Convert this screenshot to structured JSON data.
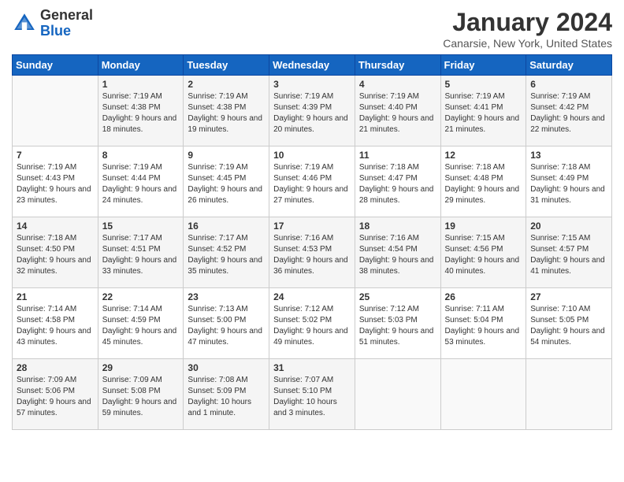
{
  "header": {
    "logo": {
      "line1": "General",
      "line2": "Blue"
    },
    "title": "January 2024",
    "location": "Canarsie, New York, United States"
  },
  "days_of_week": [
    "Sunday",
    "Monday",
    "Tuesday",
    "Wednesday",
    "Thursday",
    "Friday",
    "Saturday"
  ],
  "weeks": [
    [
      {
        "num": "",
        "sunrise": "",
        "sunset": "",
        "daylight": ""
      },
      {
        "num": "1",
        "sunrise": "Sunrise: 7:19 AM",
        "sunset": "Sunset: 4:38 PM",
        "daylight": "Daylight: 9 hours and 18 minutes."
      },
      {
        "num": "2",
        "sunrise": "Sunrise: 7:19 AM",
        "sunset": "Sunset: 4:38 PM",
        "daylight": "Daylight: 9 hours and 19 minutes."
      },
      {
        "num": "3",
        "sunrise": "Sunrise: 7:19 AM",
        "sunset": "Sunset: 4:39 PM",
        "daylight": "Daylight: 9 hours and 20 minutes."
      },
      {
        "num": "4",
        "sunrise": "Sunrise: 7:19 AM",
        "sunset": "Sunset: 4:40 PM",
        "daylight": "Daylight: 9 hours and 21 minutes."
      },
      {
        "num": "5",
        "sunrise": "Sunrise: 7:19 AM",
        "sunset": "Sunset: 4:41 PM",
        "daylight": "Daylight: 9 hours and 21 minutes."
      },
      {
        "num": "6",
        "sunrise": "Sunrise: 7:19 AM",
        "sunset": "Sunset: 4:42 PM",
        "daylight": "Daylight: 9 hours and 22 minutes."
      }
    ],
    [
      {
        "num": "7",
        "sunrise": "Sunrise: 7:19 AM",
        "sunset": "Sunset: 4:43 PM",
        "daylight": "Daylight: 9 hours and 23 minutes."
      },
      {
        "num": "8",
        "sunrise": "Sunrise: 7:19 AM",
        "sunset": "Sunset: 4:44 PM",
        "daylight": "Daylight: 9 hours and 24 minutes."
      },
      {
        "num": "9",
        "sunrise": "Sunrise: 7:19 AM",
        "sunset": "Sunset: 4:45 PM",
        "daylight": "Daylight: 9 hours and 26 minutes."
      },
      {
        "num": "10",
        "sunrise": "Sunrise: 7:19 AM",
        "sunset": "Sunset: 4:46 PM",
        "daylight": "Daylight: 9 hours and 27 minutes."
      },
      {
        "num": "11",
        "sunrise": "Sunrise: 7:18 AM",
        "sunset": "Sunset: 4:47 PM",
        "daylight": "Daylight: 9 hours and 28 minutes."
      },
      {
        "num": "12",
        "sunrise": "Sunrise: 7:18 AM",
        "sunset": "Sunset: 4:48 PM",
        "daylight": "Daylight: 9 hours and 29 minutes."
      },
      {
        "num": "13",
        "sunrise": "Sunrise: 7:18 AM",
        "sunset": "Sunset: 4:49 PM",
        "daylight": "Daylight: 9 hours and 31 minutes."
      }
    ],
    [
      {
        "num": "14",
        "sunrise": "Sunrise: 7:18 AM",
        "sunset": "Sunset: 4:50 PM",
        "daylight": "Daylight: 9 hours and 32 minutes."
      },
      {
        "num": "15",
        "sunrise": "Sunrise: 7:17 AM",
        "sunset": "Sunset: 4:51 PM",
        "daylight": "Daylight: 9 hours and 33 minutes."
      },
      {
        "num": "16",
        "sunrise": "Sunrise: 7:17 AM",
        "sunset": "Sunset: 4:52 PM",
        "daylight": "Daylight: 9 hours and 35 minutes."
      },
      {
        "num": "17",
        "sunrise": "Sunrise: 7:16 AM",
        "sunset": "Sunset: 4:53 PM",
        "daylight": "Daylight: 9 hours and 36 minutes."
      },
      {
        "num": "18",
        "sunrise": "Sunrise: 7:16 AM",
        "sunset": "Sunset: 4:54 PM",
        "daylight": "Daylight: 9 hours and 38 minutes."
      },
      {
        "num": "19",
        "sunrise": "Sunrise: 7:15 AM",
        "sunset": "Sunset: 4:56 PM",
        "daylight": "Daylight: 9 hours and 40 minutes."
      },
      {
        "num": "20",
        "sunrise": "Sunrise: 7:15 AM",
        "sunset": "Sunset: 4:57 PM",
        "daylight": "Daylight: 9 hours and 41 minutes."
      }
    ],
    [
      {
        "num": "21",
        "sunrise": "Sunrise: 7:14 AM",
        "sunset": "Sunset: 4:58 PM",
        "daylight": "Daylight: 9 hours and 43 minutes."
      },
      {
        "num": "22",
        "sunrise": "Sunrise: 7:14 AM",
        "sunset": "Sunset: 4:59 PM",
        "daylight": "Daylight: 9 hours and 45 minutes."
      },
      {
        "num": "23",
        "sunrise": "Sunrise: 7:13 AM",
        "sunset": "Sunset: 5:00 PM",
        "daylight": "Daylight: 9 hours and 47 minutes."
      },
      {
        "num": "24",
        "sunrise": "Sunrise: 7:12 AM",
        "sunset": "Sunset: 5:02 PM",
        "daylight": "Daylight: 9 hours and 49 minutes."
      },
      {
        "num": "25",
        "sunrise": "Sunrise: 7:12 AM",
        "sunset": "Sunset: 5:03 PM",
        "daylight": "Daylight: 9 hours and 51 minutes."
      },
      {
        "num": "26",
        "sunrise": "Sunrise: 7:11 AM",
        "sunset": "Sunset: 5:04 PM",
        "daylight": "Daylight: 9 hours and 53 minutes."
      },
      {
        "num": "27",
        "sunrise": "Sunrise: 7:10 AM",
        "sunset": "Sunset: 5:05 PM",
        "daylight": "Daylight: 9 hours and 54 minutes."
      }
    ],
    [
      {
        "num": "28",
        "sunrise": "Sunrise: 7:09 AM",
        "sunset": "Sunset: 5:06 PM",
        "daylight": "Daylight: 9 hours and 57 minutes."
      },
      {
        "num": "29",
        "sunrise": "Sunrise: 7:09 AM",
        "sunset": "Sunset: 5:08 PM",
        "daylight": "Daylight: 9 hours and 59 minutes."
      },
      {
        "num": "30",
        "sunrise": "Sunrise: 7:08 AM",
        "sunset": "Sunset: 5:09 PM",
        "daylight": "Daylight: 10 hours and 1 minute."
      },
      {
        "num": "31",
        "sunrise": "Sunrise: 7:07 AM",
        "sunset": "Sunset: 5:10 PM",
        "daylight": "Daylight: 10 hours and 3 minutes."
      },
      {
        "num": "",
        "sunrise": "",
        "sunset": "",
        "daylight": ""
      },
      {
        "num": "",
        "sunrise": "",
        "sunset": "",
        "daylight": ""
      },
      {
        "num": "",
        "sunrise": "",
        "sunset": "",
        "daylight": ""
      }
    ]
  ]
}
